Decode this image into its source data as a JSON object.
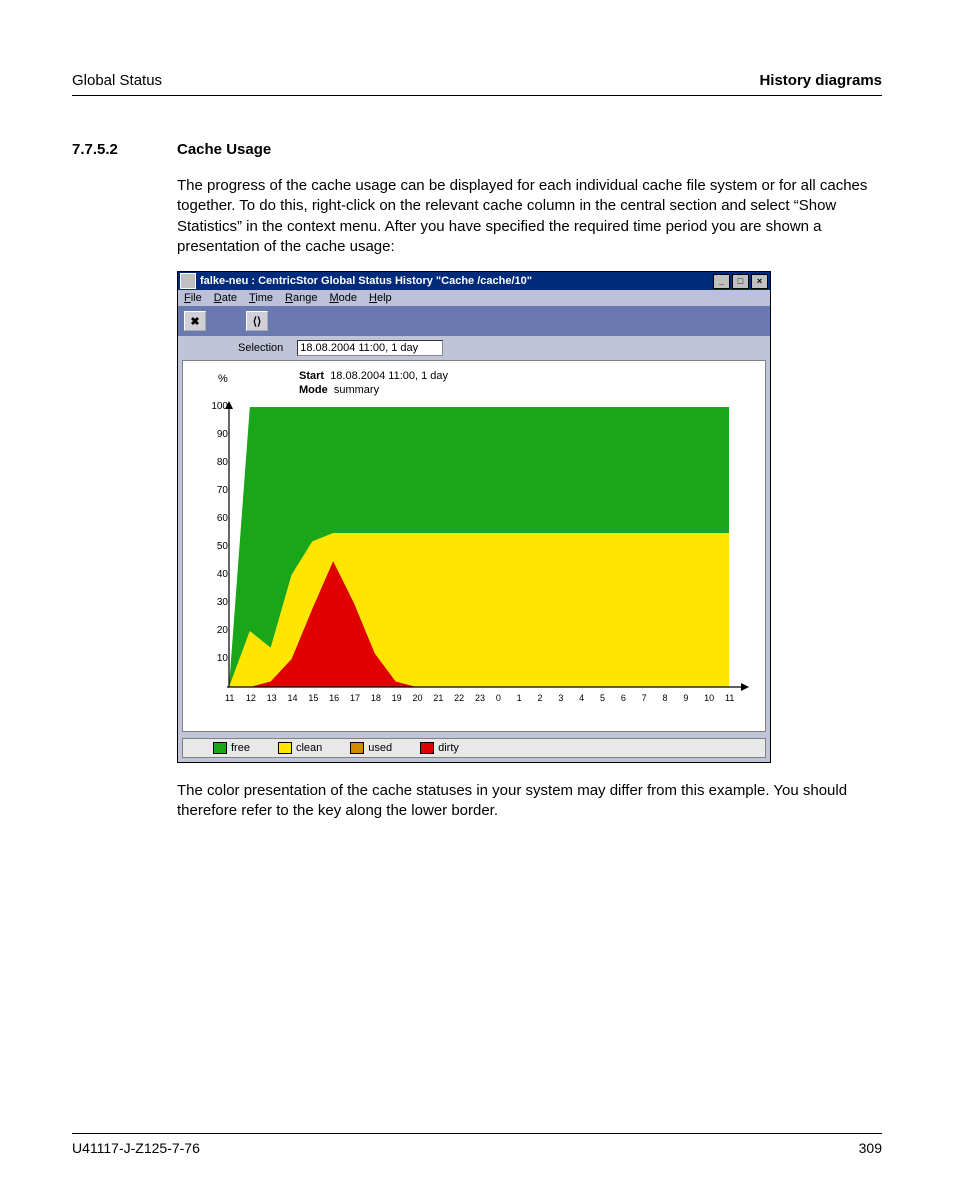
{
  "header": {
    "left": "Global Status",
    "right": "History diagrams"
  },
  "section": {
    "num": "7.7.5.2",
    "title": "Cache Usage"
  },
  "para1": "The progress of the cache usage can be displayed for each individual cache file system or for all caches together. To do this, right-click on the relevant cache column in the central section and select “Show Statistics” in the context menu. After you have specified the required time period you are shown a presentation of the cache usage:",
  "para2": "The color presentation of the cache statuses in your system may differ from this example. You should therefore refer to the key along the lower border.",
  "footer": {
    "left": "U41117-J-Z125-7-76",
    "right": "309"
  },
  "window": {
    "title": "falke-neu : CentricStor Global Status History \"Cache /cache/10\"",
    "menus": [
      "File",
      "Date",
      "Time",
      "Range",
      "Mode",
      "Help"
    ],
    "toolbar": {
      "btn1": "✖",
      "btn2": "⟨⟩"
    },
    "selection_label": "Selection",
    "selection_value": "18.08.2004 11:00, 1 day",
    "start_label": "Start",
    "start_value": "18.08.2004 11:00, 1 day",
    "mode_label": "Mode",
    "mode_value": "summary",
    "yunit": "%",
    "legend": [
      {
        "name": "free",
        "color": "#19a619"
      },
      {
        "name": "clean",
        "color": "#ffe600"
      },
      {
        "name": "used",
        "color": "#d18a00"
      },
      {
        "name": "dirty",
        "color": "#e00000"
      }
    ]
  },
  "chart_data": {
    "type": "area",
    "title": "Cache /cache/10",
    "ylabel": "%",
    "ylim": [
      0,
      100
    ],
    "x": [
      "11",
      "12",
      "13",
      "14",
      "15",
      "16",
      "17",
      "18",
      "19",
      "20",
      "21",
      "22",
      "23",
      "0",
      "1",
      "2",
      "3",
      "4",
      "5",
      "6",
      "7",
      "8",
      "9",
      "10",
      "11"
    ],
    "series": [
      {
        "name": "dirty",
        "color": "#e00000",
        "values": [
          0,
          0,
          2,
          10,
          28,
          45,
          30,
          12,
          2,
          0,
          0,
          0,
          0,
          0,
          0,
          0,
          0,
          0,
          0,
          0,
          0,
          0,
          0,
          0,
          0
        ]
      },
      {
        "name": "used",
        "color": "#d18a00",
        "values": [
          0,
          0,
          0,
          0,
          0,
          0,
          0,
          0,
          0,
          0,
          0,
          0,
          0,
          0,
          0,
          0,
          0,
          0,
          0,
          0,
          0,
          0,
          0,
          0,
          0
        ]
      },
      {
        "name": "clean",
        "color": "#ffe600",
        "values": [
          0,
          20,
          12,
          30,
          24,
          10,
          25,
          43,
          53,
          55,
          55,
          55,
          55,
          55,
          55,
          55,
          55,
          55,
          55,
          55,
          55,
          55,
          55,
          55,
          55
        ]
      },
      {
        "name": "free",
        "color": "#19a619",
        "values": [
          0,
          80,
          86,
          60,
          48,
          45,
          45,
          45,
          45,
          45,
          45,
          45,
          45,
          45,
          45,
          45,
          45,
          45,
          45,
          45,
          45,
          45,
          45,
          45,
          45
        ]
      }
    ],
    "note": "stacked; values sum to 100 where data is present; first tick (11) has no data shown"
  }
}
